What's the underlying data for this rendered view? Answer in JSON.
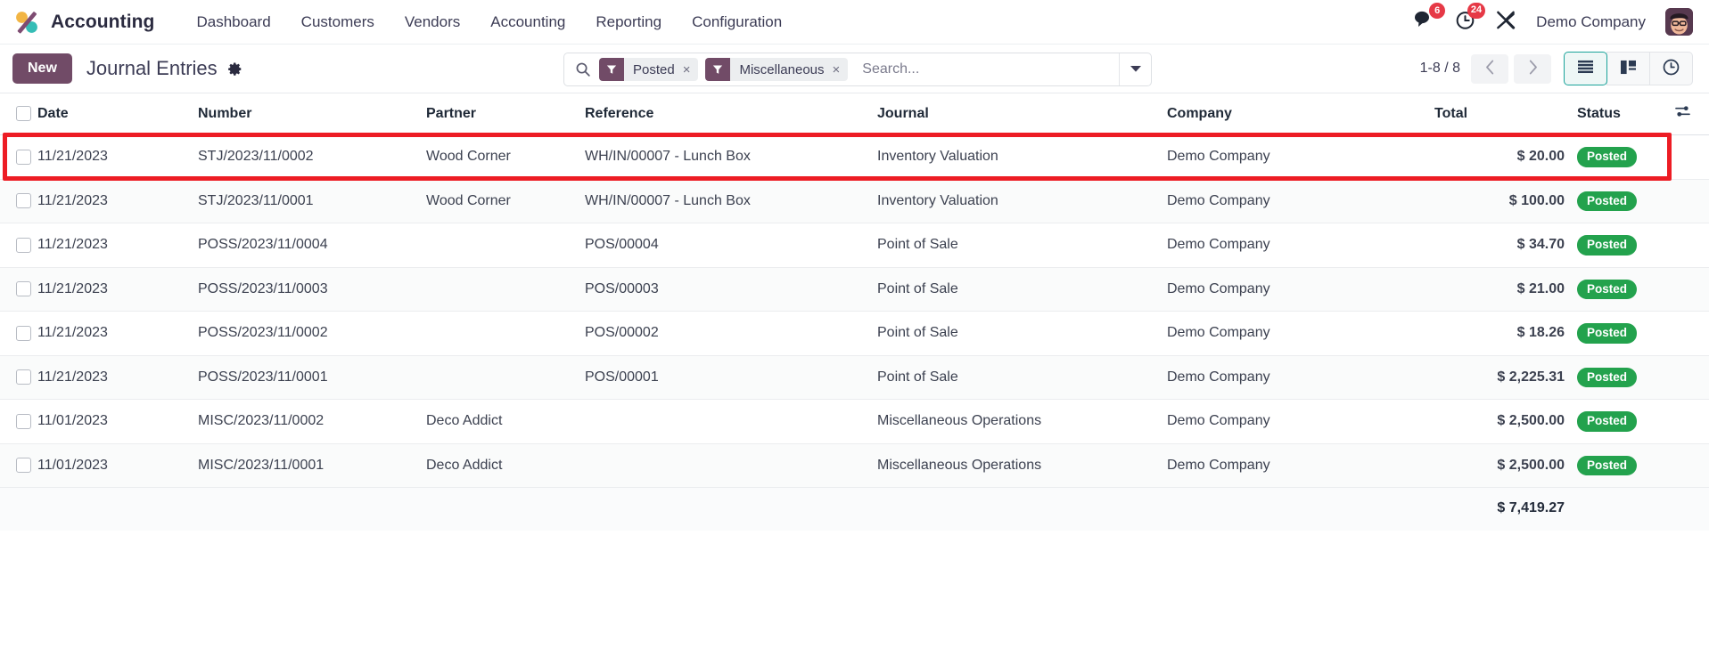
{
  "navbar": {
    "logo_icon": "odoo-accounting-logo",
    "app_name": "Accounting",
    "menu": [
      {
        "label": "Dashboard"
      },
      {
        "label": "Customers"
      },
      {
        "label": "Vendors"
      },
      {
        "label": "Accounting"
      },
      {
        "label": "Reporting"
      },
      {
        "label": "Configuration"
      }
    ],
    "messages": {
      "icon": "chat-bubble-icon",
      "count": "6"
    },
    "activities": {
      "icon": "clock-icon",
      "count": "24"
    },
    "tools_icon": "wrench-screwdriver-icon",
    "company": "Demo Company",
    "avatar_icon": "user-avatar"
  },
  "control_panel": {
    "new_label": "New",
    "title": "Journal Entries",
    "gear_icon": "gear-icon",
    "search": {
      "search_icon": "search-icon",
      "placeholder": "Search...",
      "value": "",
      "toggle_icon": "chevron-down-icon",
      "facets": [
        {
          "icon": "filter-funnel-icon",
          "label": "Posted",
          "remove": "×"
        },
        {
          "icon": "filter-funnel-icon",
          "label": "Miscellaneous",
          "remove": "×"
        }
      ]
    },
    "pager": {
      "range": "1-8 / 8",
      "prev_icon": "chevron-left-icon",
      "next_icon": "chevron-right-icon"
    },
    "views": [
      {
        "name": "list",
        "icon": "list-view-icon",
        "active": true
      },
      {
        "name": "kanban",
        "icon": "kanban-view-icon",
        "active": false
      },
      {
        "name": "activity",
        "icon": "activity-clock-view-icon",
        "active": false
      }
    ]
  },
  "table": {
    "columns": {
      "date": "Date",
      "number": "Number",
      "partner": "Partner",
      "reference": "Reference",
      "journal": "Journal",
      "company": "Company",
      "total": "Total",
      "status": "Status"
    },
    "options_icon": "adjust-columns-icon",
    "rows": [
      {
        "date": "11/21/2023",
        "number": "STJ/2023/11/0002",
        "partner": "Wood Corner",
        "reference": "WH/IN/00007 - Lunch Box",
        "journal": "Inventory Valuation",
        "company": "Demo Company",
        "total": "$ 20.00",
        "status": "Posted",
        "highlighted": true
      },
      {
        "date": "11/21/2023",
        "number": "STJ/2023/11/0001",
        "partner": "Wood Corner",
        "reference": "WH/IN/00007 - Lunch Box",
        "journal": "Inventory Valuation",
        "company": "Demo Company",
        "total": "$ 100.00",
        "status": "Posted",
        "highlighted": false
      },
      {
        "date": "11/21/2023",
        "number": "POSS/2023/11/0004",
        "partner": "",
        "reference": "POS/00004",
        "journal": "Point of Sale",
        "company": "Demo Company",
        "total": "$ 34.70",
        "status": "Posted",
        "highlighted": false
      },
      {
        "date": "11/21/2023",
        "number": "POSS/2023/11/0003",
        "partner": "",
        "reference": "POS/00003",
        "journal": "Point of Sale",
        "company": "Demo Company",
        "total": "$ 21.00",
        "status": "Posted",
        "highlighted": false
      },
      {
        "date": "11/21/2023",
        "number": "POSS/2023/11/0002",
        "partner": "",
        "reference": "POS/00002",
        "journal": "Point of Sale",
        "company": "Demo Company",
        "total": "$ 18.26",
        "status": "Posted",
        "highlighted": false
      },
      {
        "date": "11/21/2023",
        "number": "POSS/2023/11/0001",
        "partner": "",
        "reference": "POS/00001",
        "journal": "Point of Sale",
        "company": "Demo Company",
        "total": "$ 2,225.31",
        "status": "Posted",
        "highlighted": false
      },
      {
        "date": "11/01/2023",
        "number": "MISC/2023/11/0002",
        "partner": "Deco Addict",
        "reference": "",
        "journal": "Miscellaneous Operations",
        "company": "Demo Company",
        "total": "$ 2,500.00",
        "status": "Posted",
        "highlighted": false
      },
      {
        "date": "11/01/2023",
        "number": "MISC/2023/11/0001",
        "partner": "Deco Addict",
        "reference": "",
        "journal": "Miscellaneous Operations",
        "company": "Demo Company",
        "total": "$ 2,500.00",
        "status": "Posted",
        "highlighted": false
      }
    ],
    "footer_total": "$ 7,419.27"
  },
  "annotation": {
    "type": "highlight-rectangle",
    "color": "#ed1c24",
    "target": "first-journal-entry-row"
  },
  "colors": {
    "brand_purple": "#714b67",
    "status_green": "#23a24d",
    "badge_red": "#e63946",
    "active_view_teal": "#1aa39a",
    "annotation_red": "#ed1c24"
  }
}
